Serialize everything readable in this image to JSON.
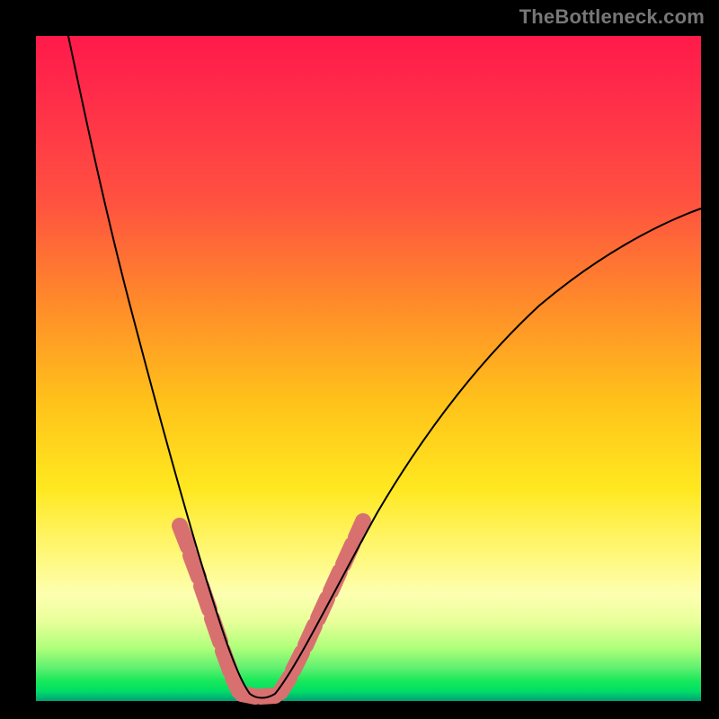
{
  "watermark": "TheBottleneck.com",
  "colors": {
    "frame": "#000000",
    "curve": "#000000",
    "marker": "#d97070",
    "gradient_stops": [
      "#ff1a4a",
      "#ff5240",
      "#ff8a2a",
      "#ffc21a",
      "#ffe820",
      "#fdffb0",
      "#60f070",
      "#00df66"
    ]
  },
  "chart_data": {
    "type": "line",
    "title": "",
    "xlabel": "",
    "ylabel": "",
    "xlim": [
      0,
      100
    ],
    "ylim": [
      0,
      100
    ],
    "grid": false,
    "legend": false,
    "annotations": [
      "TheBottleneck.com"
    ],
    "note": "Axes unlabeled in source image; x and y taken as 0–100% of plot area (x left→right, y bottom→top). Curve is a V-shaped bottleneck profile with minimum near x≈32–35, y≈0.",
    "series": [
      {
        "name": "bottleneck-curve",
        "x": [
          5,
          8,
          12,
          16,
          20,
          23,
          26,
          29,
          31,
          33,
          35,
          38,
          41,
          45,
          50,
          56,
          63,
          71,
          80,
          90,
          100
        ],
        "y": [
          100,
          84,
          66,
          50,
          36,
          26,
          17,
          9,
          3,
          0.5,
          0.5,
          3,
          8,
          15,
          24,
          34,
          44,
          54,
          62,
          69,
          74
        ]
      }
    ],
    "highlighted_segments": {
      "description": "Thick salmon dash-like marker segments overlaid on the curve near the trough region.",
      "left_branch_x_range": [
        22,
        31
      ],
      "right_branch_x_range": [
        35,
        48
      ],
      "trough_x_range": [
        31,
        36
      ]
    }
  }
}
